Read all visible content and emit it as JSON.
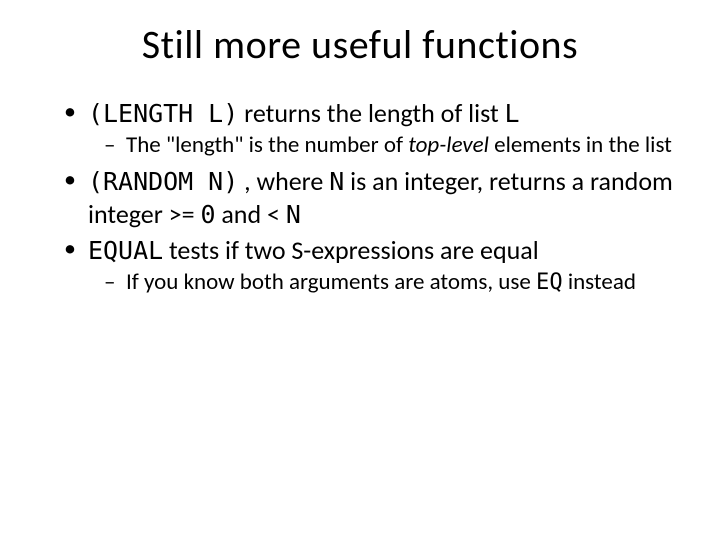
{
  "title": "Still more useful functions",
  "bullets": {
    "b1": {
      "code1": "(LENGTH L)",
      "t1": " returns the length of list ",
      "code2": "L",
      "sub": {
        "t1": "The \"length\" is the number of ",
        "ital": "top-level",
        "t2": " elements in the list"
      }
    },
    "b2": {
      "code1": "(RANDOM N)",
      "t1": " , where ",
      "code2": "N",
      "t2": " is an integer, returns a random integer >= ",
      "code3": "0",
      "t3": " and < ",
      "code4": "N"
    },
    "b3": {
      "code1": "EQUAL",
      "t1": " tests if two S-expressions are equal",
      "sub": {
        "t1": "If you know both arguments are atoms, use ",
        "code1": "EQ",
        "t2": " instead"
      }
    }
  }
}
